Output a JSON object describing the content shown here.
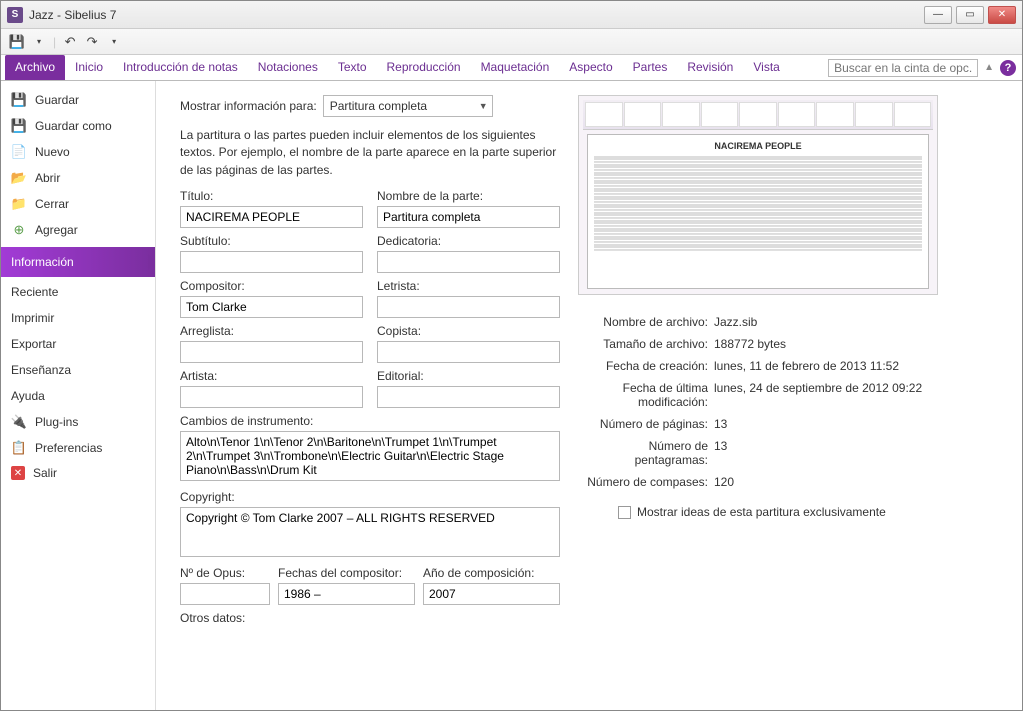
{
  "window": {
    "title": "Jazz - Sibelius 7"
  },
  "ribbon": {
    "tabs": [
      "Archivo",
      "Inicio",
      "Introducción de notas",
      "Notaciones",
      "Texto",
      "Reproducción",
      "Maquetación",
      "Aspecto",
      "Partes",
      "Revisión",
      "Vista"
    ],
    "search_placeholder": "Buscar en la cinta de opc..."
  },
  "sidebar": {
    "items": [
      {
        "icon": "save-icon",
        "label": "Guardar"
      },
      {
        "icon": "save-as-icon",
        "label": "Guardar como"
      },
      {
        "icon": "new-icon",
        "label": "Nuevo"
      },
      {
        "icon": "open-icon",
        "label": "Abrir"
      },
      {
        "icon": "close-icon",
        "label": "Cerrar"
      },
      {
        "icon": "add-icon",
        "label": "Agregar"
      }
    ],
    "selected": "Información",
    "secondary": [
      "Reciente",
      "Imprimir",
      "Exportar",
      "Enseñanza",
      "Ayuda"
    ],
    "footer": [
      {
        "icon": "plugin-icon",
        "label": "Plug-ins"
      },
      {
        "icon": "prefs-icon",
        "label": "Preferencias"
      },
      {
        "icon": "exit-icon",
        "label": "Salir"
      }
    ]
  },
  "form": {
    "show_for_label": "Mostrar información para:",
    "show_for_value": "Partitura completa",
    "description": "La partitura o las partes pueden incluir elementos de los siguientes textos. Por ejemplo, el nombre de la parte aparece en la parte superior de las páginas de las partes.",
    "labels": {
      "title": "Título:",
      "part_name": "Nombre de la parte:",
      "subtitle": "Subtítulo:",
      "dedication": "Dedicatoria:",
      "composer": "Compositor:",
      "lyricist": "Letrista:",
      "arranger": "Arreglista:",
      "copyist": "Copista:",
      "artist": "Artista:",
      "publisher": "Editorial:",
      "instrument_changes": "Cambios de instrumento:",
      "copyright": "Copyright:",
      "opus": "Nº de Opus:",
      "composer_dates": "Fechas del compositor:",
      "composition_year": "Año de composición:",
      "other": "Otros datos:"
    },
    "values": {
      "title": "NACIREMA PEOPLE",
      "part_name": "Partitura completa",
      "subtitle": "",
      "dedication": "",
      "composer": "Tom Clarke",
      "lyricist": "",
      "arranger": "",
      "copyist": "",
      "artist": "",
      "publisher": "",
      "instrument_changes": "Alto\\n\\Tenor 1\\n\\Tenor 2\\n\\Baritone\\n\\Trumpet 1\\n\\Trumpet 2\\n\\Trumpet 3\\n\\Trombone\\n\\Electric Guitar\\n\\Electric Stage Piano\\n\\Bass\\n\\Drum Kit",
      "copyright": "Copyright © Tom Clarke 2007 – ALL RIGHTS RESERVED",
      "opus": "",
      "composer_dates": "1986 –",
      "composition_year": "2007"
    }
  },
  "right": {
    "preview_title": "NACIREMA PEOPLE",
    "meta": {
      "filename_k": "Nombre de archivo:",
      "filename_v": "Jazz.sib",
      "filesize_k": "Tamaño de archivo:",
      "filesize_v": "188772 bytes",
      "created_k": "Fecha de creación:",
      "created_v": "lunes, 11 de febrero de 2013 11:52",
      "modified_k": "Fecha de última modificación:",
      "modified_v": "lunes, 24 de septiembre de 2012 09:22",
      "pages_k": "Número de páginas:",
      "pages_v": "13",
      "staves_k": "Número de pentagramas:",
      "staves_v": "13",
      "bars_k": "Número de compases:",
      "bars_v": "120"
    },
    "checkbox_label": "Mostrar ideas de esta partitura exclusivamente"
  }
}
